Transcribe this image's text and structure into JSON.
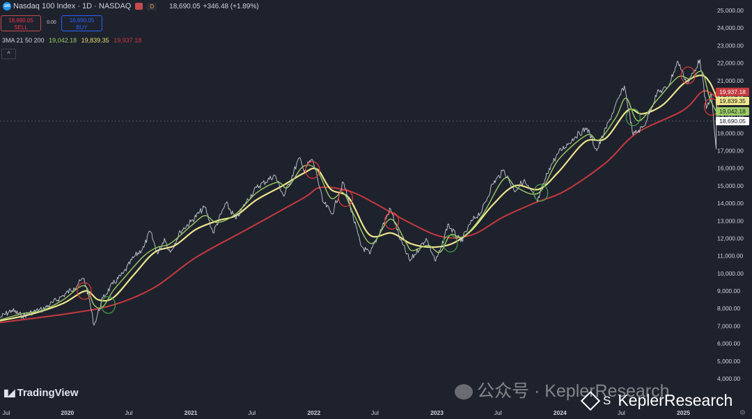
{
  "header": {
    "logo_text": "100",
    "title": "Nasdaq 100 Index · 1D · NASDAQ",
    "interval_badge": "D",
    "price": "18,690.05",
    "change": "+346.48 (+1.89%)"
  },
  "trade": {
    "sell_price": "18,690.05",
    "sell_label": "SELL",
    "spread": "0.00",
    "buy_price": "18,690.05",
    "buy_label": "BUY"
  },
  "ma_legend": {
    "label": "3MA 21 50 200",
    "ma21": "19,042.18",
    "ma50": "19,839.35",
    "ma200": "19,937.18"
  },
  "collapse_icon": "^",
  "branding": {
    "tradingview": "TradingView",
    "watermark_cn": "公众号 · KeplerResearch",
    "watermark_s": "S",
    "watermark_en": "KeplerResearch"
  },
  "colors": {
    "background": "#1e222d",
    "price": "#c9ccd6",
    "ma21": "#9ccc65",
    "ma50": "#f0e68c",
    "ma200": "#c43a3f",
    "signal_sell_circle": "#e53935",
    "signal_buy_circle": "#43a047"
  },
  "chart_data": {
    "type": "line",
    "title": "Nasdaq 100 Index · 1D · NASDAQ",
    "xlabel": "",
    "ylabel": "",
    "x_ticks": [
      "Jul",
      "2020",
      "Jul",
      "2021",
      "Jul",
      "2022",
      "Jul",
      "2023",
      "Jul",
      "2024",
      "Jul",
      "2025"
    ],
    "y_ticks": [
      "25,000.00",
      "24,000.00",
      "23,000.00",
      "22,000.00",
      "21,000.00",
      "20,000.00",
      "19,000.00",
      "18,000.00",
      "17,000.00",
      "16,000.00",
      "15,000.00",
      "14,000.00",
      "13,000.00",
      "12,000.00",
      "11,000.00",
      "10,000.00",
      "9,000.00",
      "8,000.00",
      "7,000.00",
      "6,000.00",
      "5,000.00",
      "4,000.00"
    ],
    "ylim": [
      3500,
      25500
    ],
    "xlim": [
      "2019-06-15",
      "2025-04-05"
    ],
    "grid": false,
    "last_price_line": 18690.05,
    "price_labels": [
      {
        "text": "19,937.18",
        "value": 19937.18,
        "series": "MA 200"
      },
      {
        "text": "19,839.35",
        "value": 19839.35,
        "series": "MA 50"
      },
      {
        "text": "19,042.18",
        "value": 19042.18,
        "series": "MA 21"
      },
      {
        "text": "18,690.05",
        "value": 18690.05,
        "series": "Price"
      }
    ],
    "series": [
      {
        "name": "Price",
        "points": [
          [
            "2019-06-15",
            7480
          ],
          [
            "2019-07-20",
            7900
          ],
          [
            "2019-08-20",
            7580
          ],
          [
            "2019-09-20",
            7800
          ],
          [
            "2019-10-20",
            7950
          ],
          [
            "2019-11-20",
            8350
          ],
          [
            "2019-12-20",
            8750
          ],
          [
            "2020-01-20",
            9180
          ],
          [
            "2020-02-19",
            9720
          ],
          [
            "2020-03-05",
            8600
          ],
          [
            "2020-03-20",
            7050
          ],
          [
            "2020-04-15",
            8600
          ],
          [
            "2020-05-15",
            9400
          ],
          [
            "2020-06-15",
            10000
          ],
          [
            "2020-07-15",
            10900
          ],
          [
            "2020-08-15",
            11500
          ],
          [
            "2020-09-02",
            12420
          ],
          [
            "2020-09-25",
            11100
          ],
          [
            "2020-10-15",
            12000
          ],
          [
            "2020-11-01",
            11200
          ],
          [
            "2020-12-01",
            12400
          ],
          [
            "2021-01-01",
            12950
          ],
          [
            "2021-02-12",
            13800
          ],
          [
            "2021-03-08",
            12300
          ],
          [
            "2021-04-15",
            14000
          ],
          [
            "2021-05-15",
            13100
          ],
          [
            "2021-06-15",
            14100
          ],
          [
            "2021-07-15",
            14900
          ],
          [
            "2021-09-07",
            15600
          ],
          [
            "2021-10-04",
            14400
          ],
          [
            "2021-11-19",
            16600
          ],
          [
            "2021-12-01",
            15900
          ],
          [
            "2021-12-27",
            16500
          ],
          [
            "2022-01-10",
            15600
          ],
          [
            "2022-01-27",
            14100
          ],
          [
            "2022-02-24",
            13400
          ],
          [
            "2022-03-29",
            15200
          ],
          [
            "2022-04-15",
            14100
          ],
          [
            "2022-05-20",
            11600
          ],
          [
            "2022-06-16",
            11100
          ],
          [
            "2022-08-16",
            13700
          ],
          [
            "2022-09-15",
            11900
          ],
          [
            "2022-10-13",
            10700
          ],
          [
            "2022-11-30",
            12000
          ],
          [
            "2022-12-28",
            10700
          ],
          [
            "2023-01-15",
            11500
          ],
          [
            "2023-02-02",
            12800
          ],
          [
            "2023-03-13",
            11800
          ],
          [
            "2023-04-15",
            13000
          ],
          [
            "2023-05-15",
            13600
          ],
          [
            "2023-06-15",
            15100
          ],
          [
            "2023-07-19",
            15900
          ],
          [
            "2023-08-18",
            14700
          ],
          [
            "2023-09-15",
            15300
          ],
          [
            "2023-10-26",
            14100
          ],
          [
            "2023-11-30",
            16000
          ],
          [
            "2023-12-28",
            16900
          ],
          [
            "2024-02-15",
            17800
          ],
          [
            "2024-03-21",
            18300
          ],
          [
            "2024-04-19",
            17000
          ],
          [
            "2024-05-28",
            18800
          ],
          [
            "2024-07-10",
            20700
          ],
          [
            "2024-08-05",
            17900
          ],
          [
            "2024-09-06",
            18400
          ],
          [
            "2024-10-15",
            20300
          ],
          [
            "2024-11-15",
            20600
          ],
          [
            "2024-12-16",
            22100
          ],
          [
            "2025-01-13",
            20800
          ],
          [
            "2025-02-19",
            22200
          ],
          [
            "2025-03-10",
            19400
          ],
          [
            "2025-03-25",
            20200
          ],
          [
            "2025-04-08",
            17100
          ],
          [
            "2025-04-09",
            19800
          ],
          [
            "2025-04-14",
            18690
          ]
        ]
      },
      {
        "name": "MA 21",
        "points": [
          [
            "2019-06-15",
            7350
          ],
          [
            "2019-08-20",
            7700
          ],
          [
            "2019-10-20",
            7900
          ],
          [
            "2019-12-20",
            8500
          ],
          [
            "2020-02-19",
            9300
          ],
          [
            "2020-03-20",
            8200
          ],
          [
            "2020-04-15",
            8100
          ],
          [
            "2020-05-15",
            9000
          ],
          [
            "2020-06-15",
            9700
          ],
          [
            "2020-08-15",
            11000
          ],
          [
            "2020-09-25",
            11500
          ],
          [
            "2020-11-01",
            11700
          ],
          [
            "2021-01-01",
            12700
          ],
          [
            "2021-02-12",
            13300
          ],
          [
            "2021-03-20",
            12900
          ],
          [
            "2021-05-15",
            13400
          ],
          [
            "2021-07-15",
            14600
          ],
          [
            "2021-09-15",
            15200
          ],
          [
            "2021-10-15",
            14900
          ],
          [
            "2021-11-30",
            16100
          ],
          [
            "2022-01-10",
            15900
          ],
          [
            "2022-02-20",
            14300
          ],
          [
            "2022-03-29",
            14600
          ],
          [
            "2022-05-01",
            13300
          ],
          [
            "2022-06-20",
            11700
          ],
          [
            "2022-08-16",
            13100
          ],
          [
            "2022-09-30",
            11800
          ],
          [
            "2022-10-20",
            11300
          ],
          [
            "2022-12-05",
            11600
          ],
          [
            "2023-01-10",
            11200
          ],
          [
            "2023-02-10",
            12200
          ],
          [
            "2023-03-20",
            12100
          ],
          [
            "2023-05-15",
            13300
          ],
          [
            "2023-07-19",
            15400
          ],
          [
            "2023-08-25",
            14900
          ],
          [
            "2023-10-30",
            14600
          ],
          [
            "2023-12-28",
            16500
          ],
          [
            "2024-03-21",
            17900
          ],
          [
            "2024-04-25",
            17600
          ],
          [
            "2024-06-15",
            18900
          ],
          [
            "2024-07-15",
            20000
          ],
          [
            "2024-08-20",
            18700
          ],
          [
            "2024-10-15",
            19900
          ],
          [
            "2024-12-16",
            21200
          ],
          [
            "2025-01-20",
            21100
          ],
          [
            "2025-02-25",
            21500
          ],
          [
            "2025-03-20",
            20000
          ],
          [
            "2025-04-14",
            19042
          ]
        ]
      },
      {
        "name": "MA 50",
        "points": [
          [
            "2019-06-15",
            7300
          ],
          [
            "2019-09-20",
            7700
          ],
          [
            "2019-12-20",
            8300
          ],
          [
            "2020-02-24",
            9000
          ],
          [
            "2020-04-01",
            8500
          ],
          [
            "2020-05-15",
            8600
          ],
          [
            "2020-07-15",
            9900
          ],
          [
            "2020-09-15",
            11200
          ],
          [
            "2020-11-15",
            11600
          ],
          [
            "2021-01-15",
            12500
          ],
          [
            "2021-03-20",
            13000
          ],
          [
            "2021-05-15",
            13300
          ],
          [
            "2021-07-15",
            14200
          ],
          [
            "2021-09-30",
            15000
          ],
          [
            "2021-11-30",
            15700
          ],
          [
            "2022-01-10",
            15950
          ],
          [
            "2022-02-20",
            14800
          ],
          [
            "2022-04-15",
            14300
          ],
          [
            "2022-06-15",
            12200
          ],
          [
            "2022-08-20",
            12300
          ],
          [
            "2022-10-15",
            11700
          ],
          [
            "2022-12-15",
            11500
          ],
          [
            "2023-02-15",
            11700
          ],
          [
            "2023-04-15",
            12500
          ],
          [
            "2023-06-15",
            13900
          ],
          [
            "2023-08-20",
            15000
          ],
          [
            "2023-10-30",
            14800
          ],
          [
            "2023-12-28",
            15800
          ],
          [
            "2024-03-15",
            17500
          ],
          [
            "2024-05-15",
            17700
          ],
          [
            "2024-07-20",
            19300
          ],
          [
            "2024-09-01",
            19100
          ],
          [
            "2024-10-31",
            19600
          ],
          [
            "2024-12-31",
            20800
          ],
          [
            "2025-02-20",
            21300
          ],
          [
            "2025-03-20",
            20900
          ],
          [
            "2025-04-14",
            19839
          ]
        ]
      },
      {
        "name": "MA 200",
        "points": [
          [
            "2019-06-15",
            7200
          ],
          [
            "2019-12-31",
            7700
          ],
          [
            "2020-05-15",
            8200
          ],
          [
            "2020-09-15",
            9200
          ],
          [
            "2021-01-15",
            10900
          ],
          [
            "2021-06-15",
            12500
          ],
          [
            "2021-12-01",
            14300
          ],
          [
            "2022-01-20",
            14900
          ],
          [
            "2022-04-15",
            14700
          ],
          [
            "2022-07-01",
            14000
          ],
          [
            "2022-10-01",
            13000
          ],
          [
            "2023-01-15",
            12100
          ],
          [
            "2023-04-15",
            12200
          ],
          [
            "2023-07-15",
            13200
          ],
          [
            "2023-10-15",
            14000
          ],
          [
            "2024-01-15",
            14700
          ],
          [
            "2024-05-15",
            16300
          ],
          [
            "2024-08-15",
            18000
          ],
          [
            "2024-12-31",
            19300
          ],
          [
            "2025-03-01",
            20400
          ],
          [
            "2025-04-14",
            19937
          ]
        ]
      }
    ],
    "annotations": [
      {
        "type": "circle",
        "color": "red",
        "date": "2020-02-20",
        "value": 9000
      },
      {
        "type": "circle",
        "color": "green",
        "date": "2020-05-01",
        "value": 8200
      },
      {
        "type": "circle",
        "color": "red",
        "date": "2021-12-28",
        "value": 15900
      },
      {
        "type": "circle",
        "color": "red",
        "date": "2022-04-05",
        "value": 14300
      },
      {
        "type": "circle",
        "color": "red",
        "date": "2022-08-20",
        "value": 13000
      },
      {
        "type": "circle",
        "color": "green",
        "date": "2023-02-10",
        "value": 11700
      },
      {
        "type": "circle",
        "color": "green",
        "date": "2023-11-05",
        "value": 14600
      },
      {
        "type": "circle",
        "color": "green",
        "date": "2024-08-05",
        "value": 18900
      },
      {
        "type": "circle",
        "color": "red",
        "date": "2025-01-15",
        "value": 21300
      },
      {
        "type": "circle",
        "color": "red",
        "date": "2025-03-25",
        "value": 19500
      }
    ]
  }
}
